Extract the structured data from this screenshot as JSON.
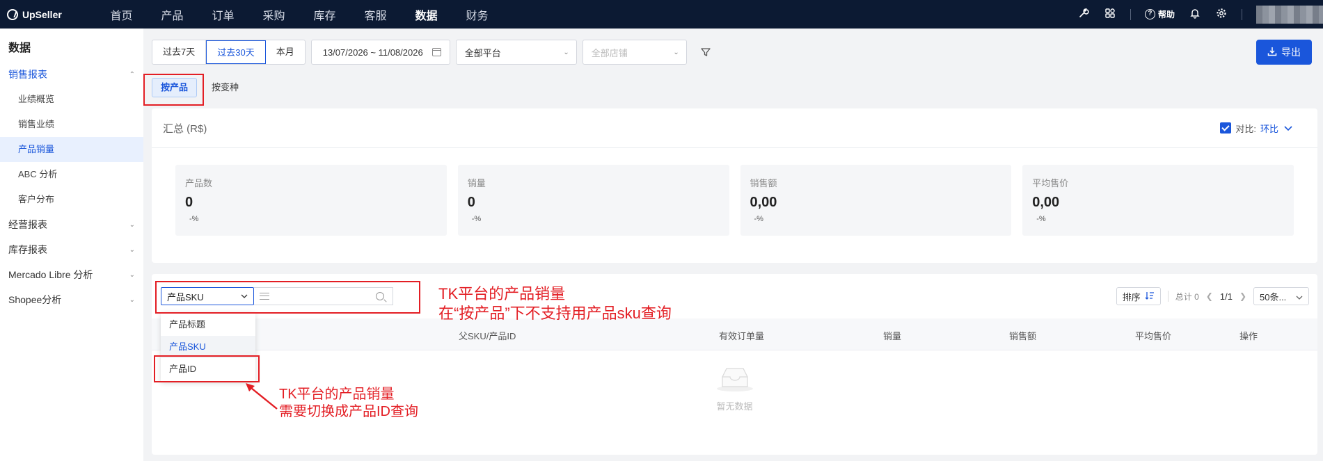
{
  "topnav": {
    "logo_text": "UpSeller",
    "items": [
      {
        "label": "首页",
        "active": false
      },
      {
        "label": "产品",
        "active": false
      },
      {
        "label": "订单",
        "active": false
      },
      {
        "label": "采购",
        "active": false
      },
      {
        "label": "库存",
        "active": false
      },
      {
        "label": "客服",
        "active": false
      },
      {
        "label": "数据",
        "active": true
      },
      {
        "label": "财务",
        "active": false
      }
    ],
    "help_label": "帮助",
    "icons": [
      "wrench-icon",
      "apps-grid-icon",
      "help-circle-icon",
      "bell-icon",
      "gear-icon"
    ]
  },
  "sidebar": {
    "title": "数据",
    "groups": [
      {
        "label": "销售报表",
        "open": true,
        "items": [
          "业绩概览",
          "销售业绩",
          "产品销量",
          "ABC 分析",
          "客户分布"
        ],
        "active_item": "产品销量"
      },
      {
        "label": "经营报表",
        "open": false
      },
      {
        "label": "库存报表",
        "open": false
      },
      {
        "label": "Mercado Libre 分析",
        "open": false
      },
      {
        "label": "Shopee分析",
        "open": false
      }
    ]
  },
  "filters": {
    "date_ranges": [
      "过去7天",
      "过去30天",
      "本月"
    ],
    "active_range": "过去30天",
    "date_value": "13/07/2026 ~ 11/08/2026",
    "platform": "全部平台",
    "shop_placeholder": "全部店铺",
    "export_label": "导出"
  },
  "subtabs": {
    "items": [
      "按产品",
      "按变种"
    ],
    "active": "按产品"
  },
  "summary": {
    "title": "汇总 (R$)",
    "compare_label": "对比:",
    "compare_value": "环比",
    "compare_checked": true,
    "stats": [
      {
        "label": "产品数",
        "value": "0",
        "change": "-%"
      },
      {
        "label": "销量",
        "value": "0",
        "change": "-%"
      },
      {
        "label": "销售额",
        "value": "0,00",
        "change": "-%"
      },
      {
        "label": "平均售价",
        "value": "0,00",
        "change": "-%"
      }
    ]
  },
  "table": {
    "search_field": "产品SKU",
    "sort_label": "排序",
    "total_label": "总计 0",
    "page": "1/1",
    "page_size": "50条...",
    "columns": [
      "父SKU/产品ID",
      "有效订单量",
      "销量",
      "销售额",
      "平均售价",
      "操作"
    ],
    "empty_text": "暂无数据"
  },
  "dropdown": {
    "options": [
      "产品标题",
      "产品SKU",
      "产品ID"
    ],
    "selected": "产品SKU"
  },
  "annotations": {
    "note1_line1": "TK平台的产品销量",
    "note1_line2": "在“按产品”下不支持用产品sku查询",
    "note2_line1": "TK平台的产品销量",
    "note2_line2": "需要切换成产品ID查询",
    "color": "#e31e24"
  },
  "colors": {
    "accent": "#1a56db",
    "topnav_bg": "#0c1a33"
  }
}
